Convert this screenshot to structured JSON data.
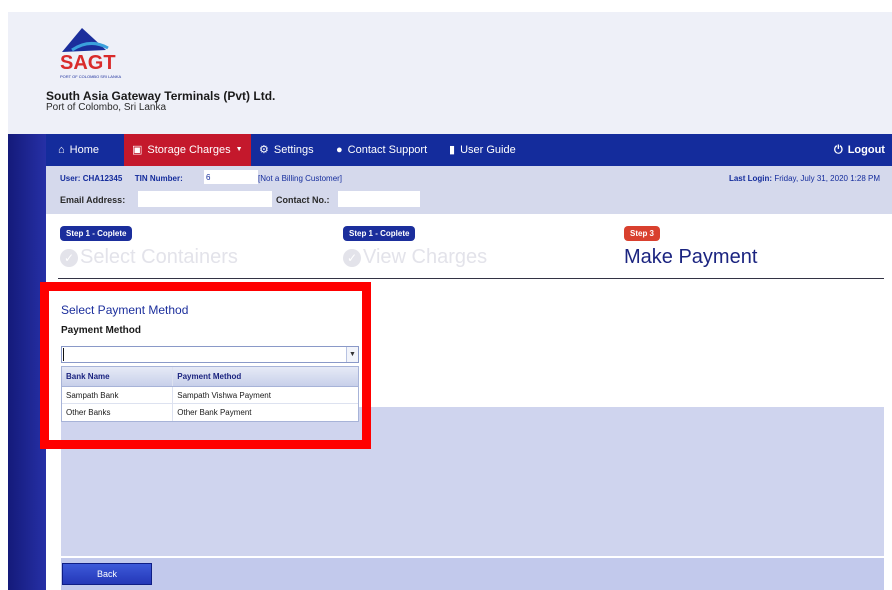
{
  "brand": {
    "logo_text": "SAGT",
    "logo_subtext": "PORT OF COLOMBO SRI LANKA",
    "company_name": "South Asia Gateway Terminals (Pvt) Ltd.",
    "company_location": "Port of Colombo, Sri Lanka",
    "colors": {
      "navy": "#142c9c",
      "red": "#c4182c",
      "accent_blue": "#1b2e9c"
    }
  },
  "nav": {
    "home": "Home",
    "storage_charges": "Storage Charges",
    "settings": "Settings",
    "contact_support": "Contact Support",
    "user_guide": "User Guide",
    "logout": "Logout",
    "icons": [
      "home-icon",
      "storage-icon",
      "gear-icon",
      "user-icon",
      "book-icon",
      "power-icon"
    ]
  },
  "user_info": {
    "user_label": "User:",
    "user_value": "CHA12345",
    "tin_label": "TIN Number:",
    "tin_value": "6",
    "billing_status": "[Not a Billing Customer]",
    "last_login_label": "Last Login:",
    "last_login_value": "Friday, July 31, 2020 1:28 PM",
    "email_label": "Email Address:",
    "email_value": "",
    "contact_label": "Contact No.:",
    "contact_value": ""
  },
  "steps": [
    {
      "badge": "Step 1 - Coplete",
      "title": "Select Containers",
      "state": "complete"
    },
    {
      "badge": "Step 1 - Coplete",
      "title": "View Charges",
      "state": "complete"
    },
    {
      "badge": "Step 3",
      "title": "Make Payment",
      "state": "active"
    }
  ],
  "payment": {
    "section_title": "Select Payment Method",
    "field_label": "Payment Method",
    "selected_value": "",
    "columns": [
      "Bank Name",
      "Payment Method"
    ],
    "options": [
      {
        "bank": "Sampath Bank",
        "method": "Sampath Vishwa Payment"
      },
      {
        "bank": "Other Banks",
        "method": "Other Bank Payment"
      }
    ]
  },
  "footer": {
    "back_label": "Back"
  }
}
